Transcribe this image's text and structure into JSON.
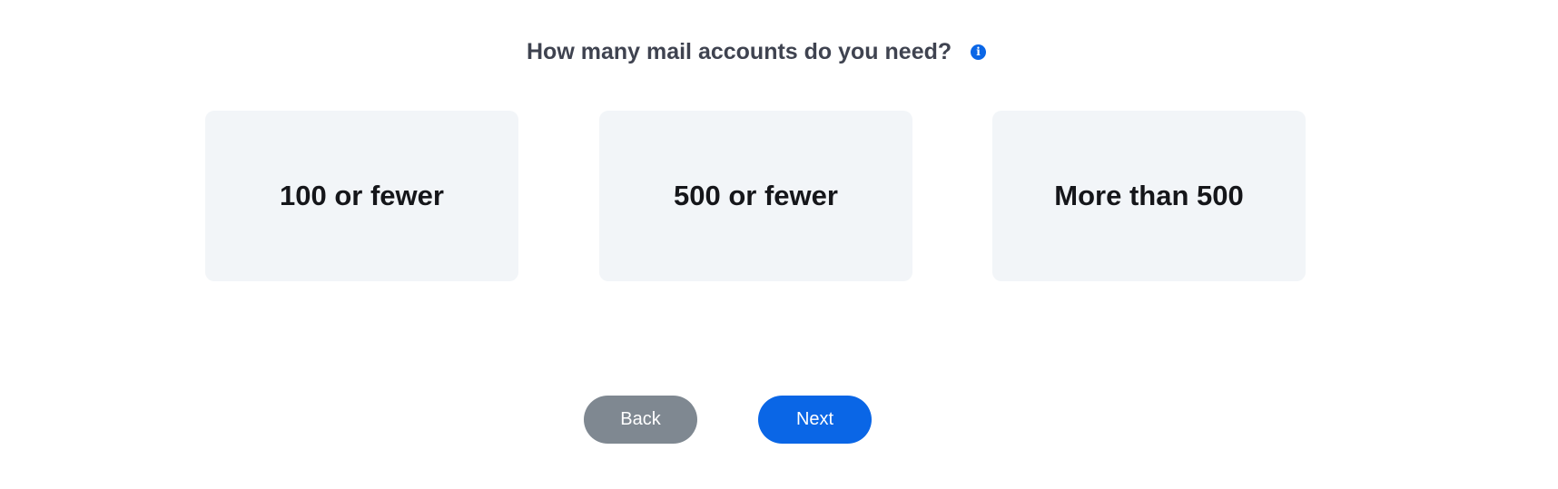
{
  "question": {
    "text": "How many mail accounts do you need?",
    "info_icon_glyph": "i"
  },
  "options": [
    {
      "label": "100 or fewer"
    },
    {
      "label": "500 or fewer"
    },
    {
      "label": "More than 500"
    }
  ],
  "buttons": {
    "back_label": "Back",
    "next_label": "Next"
  },
  "colors": {
    "accent": "#0a66e6",
    "back_button": "#7f8891",
    "card_background": "#f2f5f8",
    "question_text": "#3f4350"
  }
}
